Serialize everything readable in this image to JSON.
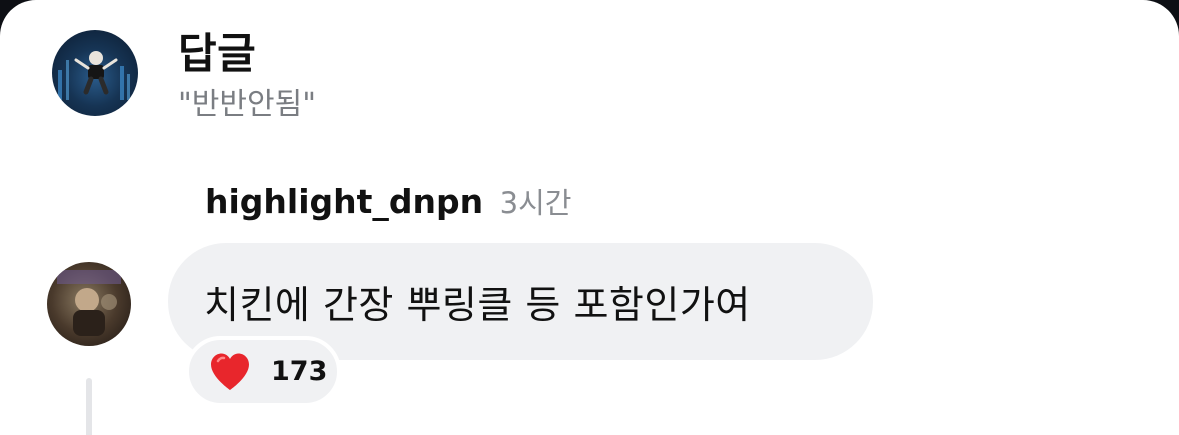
{
  "header": {
    "title": "답글",
    "subtitle": "\"반반안됨\""
  },
  "comment": {
    "username": "highlight_dnpn",
    "time": "3시간",
    "text": "치킨에 간장 뿌링클 등 포함인가여",
    "reaction_icon": "heart-icon",
    "reaction_count": "173"
  },
  "colors": {
    "bubble": "#f0f1f3",
    "heart": "#e8262c",
    "muted_text": "#7a7d82"
  }
}
